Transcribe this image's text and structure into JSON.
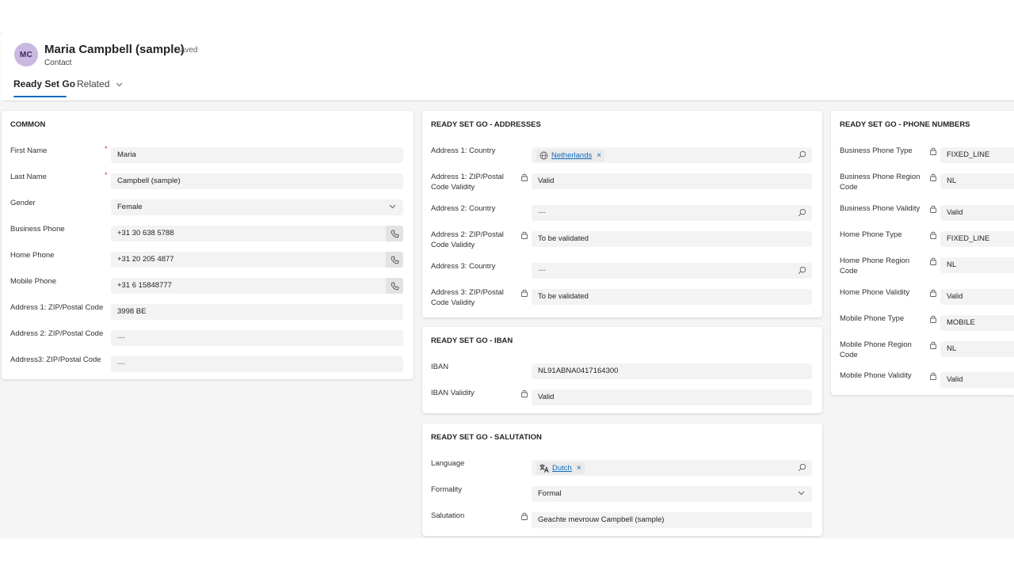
{
  "record": {
    "avatar_initials": "MC",
    "name": "Maria Campbell (sample)",
    "status": "- Saved",
    "entity": "Contact"
  },
  "tabs": [
    {
      "label": "Ready Set Go",
      "active": true
    },
    {
      "label": "Related",
      "active": false,
      "dropdown": true
    }
  ],
  "common": {
    "title": "COMMON",
    "fields": {
      "first_name": {
        "label": "First Name",
        "value": "Maria",
        "required": "*"
      },
      "last_name": {
        "label": "Last Name",
        "value": "Campbell (sample)",
        "required": "*"
      },
      "gender": {
        "label": "Gender",
        "value": "Female"
      },
      "business_phone": {
        "label": "Business Phone",
        "value": "+31 30 638 5788"
      },
      "home_phone": {
        "label": "Home Phone",
        "value": "+31 20 205 4877"
      },
      "mobile_phone": {
        "label": "Mobile Phone",
        "value": "+31 6 15848777"
      },
      "zip1": {
        "label": "Address 1: ZIP/Postal Code",
        "value": "3998 BE"
      },
      "zip2": {
        "label": "Address 2: ZIP/Postal Code",
        "value": "---"
      },
      "zip3": {
        "label": "Address3: ZIP/Postal Code",
        "value": "---"
      }
    }
  },
  "addresses": {
    "title": "READY SET GO - ADDRESSES",
    "fields": {
      "country1": {
        "label": "Address 1: Country",
        "value": "Netherlands",
        "remove": "×"
      },
      "zipv1": {
        "label": "Address 1: ZIP/Postal Code Validity",
        "value": "Valid"
      },
      "country2": {
        "label": "Address 2: Country",
        "value": "---"
      },
      "zipv2": {
        "label": "Address 2: ZIP/Postal Code Validity",
        "value": "To be validated"
      },
      "country3": {
        "label": "Address 3: Country",
        "value": "---"
      },
      "zipv3": {
        "label": "Address 3: ZIP/Postal Code Validity",
        "value": "To be validated"
      }
    }
  },
  "iban": {
    "title": "READY SET GO - IBAN",
    "fields": {
      "iban": {
        "label": "IBAN",
        "value": "NL91ABNA0417164300"
      },
      "validity": {
        "label": "IBAN Validity",
        "value": "Valid"
      }
    }
  },
  "salutation": {
    "title": "READY SET GO -  SALUTATION",
    "fields": {
      "language": {
        "label": "Language",
        "value": "Dutch",
        "remove": "×"
      },
      "formality": {
        "label": "Formality",
        "value": "Formal"
      },
      "salutation": {
        "label": "Salutation",
        "value": "Geachte mevrouw Campbell (sample)"
      }
    }
  },
  "phones": {
    "title": "READY SET GO - PHONE NUMBERS",
    "fields": {
      "bp_type": {
        "label": "Business Phone Type",
        "value": "FIXED_LINE"
      },
      "bp_region": {
        "label": "Business Phone Region Code",
        "value": "NL"
      },
      "bp_validity": {
        "label": "Business Phone Validity",
        "value": "Valid"
      },
      "hp_type": {
        "label": "Home Phone Type",
        "value": "FIXED_LINE"
      },
      "hp_region": {
        "label": "Home Phone Region Code",
        "value": "NL"
      },
      "hp_validity": {
        "label": "Home Phone Validity",
        "value": "Valid"
      },
      "mp_type": {
        "label": "Mobile Phone Type",
        "value": "MOBILE"
      },
      "mp_region": {
        "label": "Mobile Phone Region Code",
        "value": "NL"
      },
      "mp_validity": {
        "label": "Mobile Phone Validity",
        "value": "Valid"
      }
    }
  },
  "icons": {
    "lock": "lock-icon",
    "phone": "phone-icon",
    "search": "search-icon",
    "chevron": "chevron-down-icon",
    "globe": "globe-icon",
    "language": "translate-icon"
  },
  "colors": {
    "accent": "#0f6cbd",
    "avatar_bg": "#c9b8e0",
    "required": "#c4314b",
    "field_bg": "#f3f3f3",
    "canvas_bg": "#f5f5f5"
  }
}
